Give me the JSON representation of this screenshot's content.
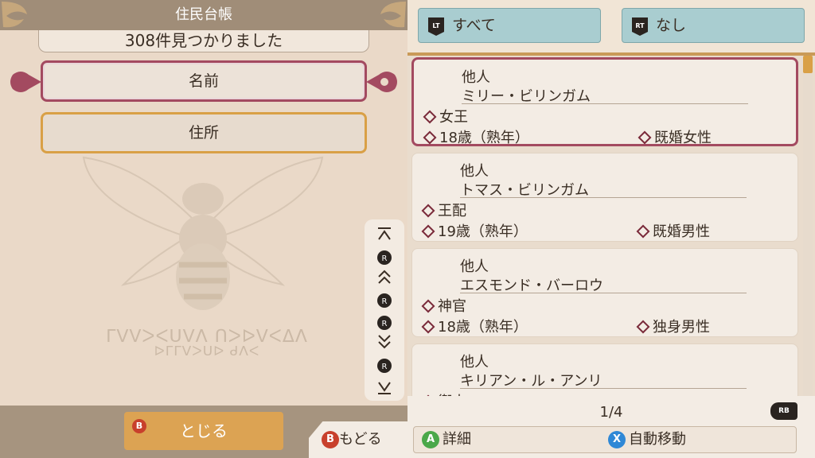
{
  "left": {
    "title": "住民台帳",
    "found_text": "308件見つかりました",
    "sort_buttons": [
      {
        "label": "名前"
      },
      {
        "label": "住所"
      }
    ],
    "close_button": {
      "badge": "B",
      "label": "とじる"
    }
  },
  "right": {
    "filters": [
      {
        "trigger": "LT",
        "label": "すべて"
      },
      {
        "trigger": "RT",
        "label": "なし"
      }
    ],
    "residents": [
      {
        "category": "他人",
        "name": "ミリー・ビリンガム",
        "role": "女王",
        "age": "18歳（熟年）",
        "status": "既婚女性",
        "selected": true
      },
      {
        "category": "他人",
        "name": "トマス・ビリンガム",
        "role": "王配",
        "age": "19歳（熟年）",
        "status": "既婚男性",
        "selected": false
      },
      {
        "category": "他人",
        "name": "エスモンド・バーロウ",
        "role": "神官",
        "age": "18歳（熟年）",
        "status": "独身男性",
        "selected": false
      },
      {
        "category": "他人",
        "name": "キリアン・ル・アンリ",
        "role": "衛士",
        "age": "",
        "status": "",
        "selected": false
      }
    ],
    "page": "1/4",
    "page_next_badge": "RB",
    "actions": [
      {
        "badge": "A",
        "label": "詳細",
        "color": "#4aa84a"
      },
      {
        "badge": "X",
        "label": "自動移動",
        "color": "#2f88d6"
      }
    ]
  },
  "back_button": {
    "badge": "B",
    "label": "もどる"
  },
  "scroll_controls": {
    "stick_badge": "R"
  },
  "colors": {
    "selected_border": "#a34a60",
    "focus_border": "#d9a046",
    "filter_bg": "#a9cdd0",
    "close_bg": "#dca353"
  }
}
